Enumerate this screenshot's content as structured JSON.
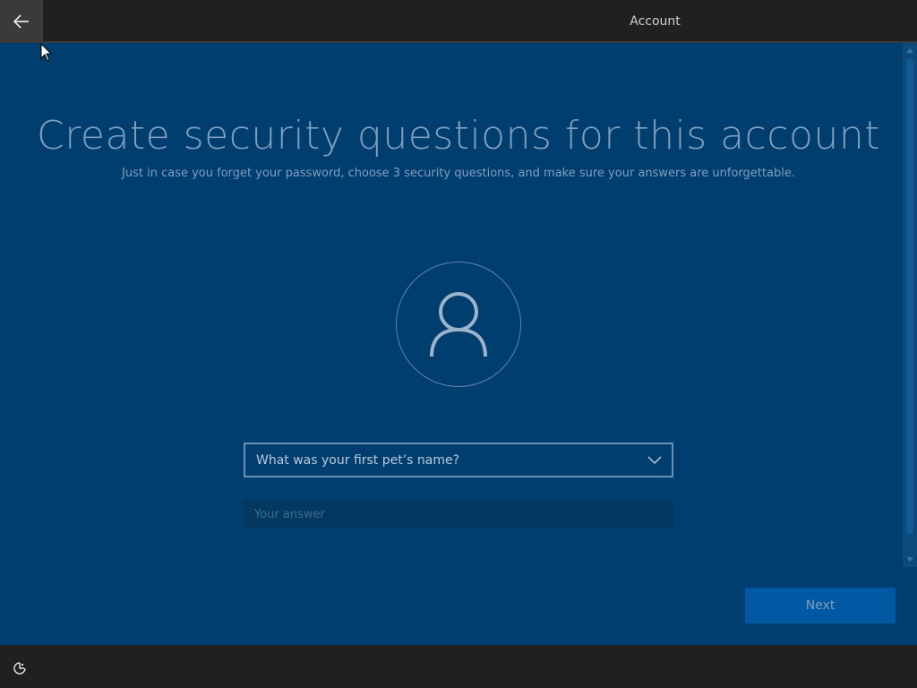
{
  "header": {
    "back_icon": "back-arrow-icon",
    "tab_label": "Account"
  },
  "main": {
    "title": "Create security questions for this account",
    "subtitle": "Just in case you forget your password, choose 3 security questions, and make sure your answers are unforgettable.",
    "avatar_icon": "user-icon",
    "question": {
      "selected": "What was your first pet’s name?",
      "dropdown_icon": "chevron-down-icon"
    },
    "answer": {
      "value": "",
      "placeholder": "Your answer"
    },
    "next_label": "Next"
  },
  "footer": {
    "ease_of_access_icon": "ease-of-access-icon"
  },
  "colors": {
    "background": "#003e6f",
    "bar": "#202020",
    "accent": "#0059a2",
    "text_dim": "#7f9fbf"
  }
}
